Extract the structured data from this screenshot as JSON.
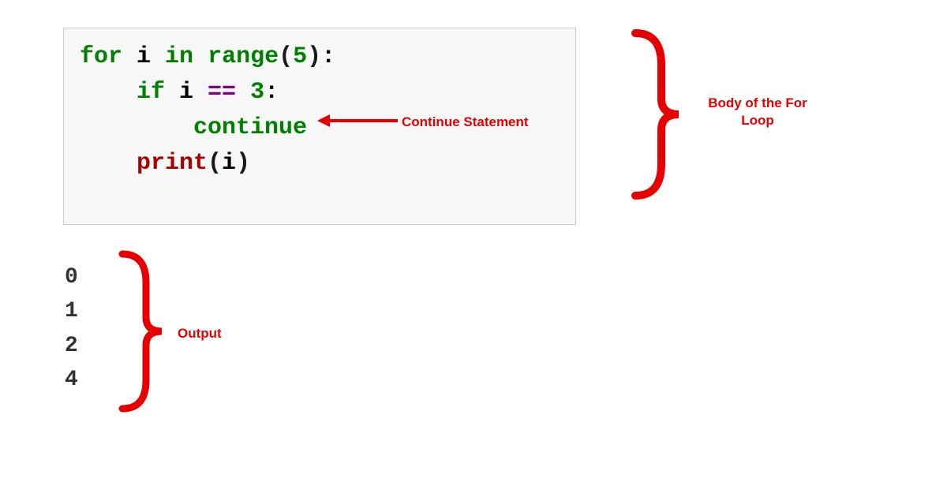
{
  "code": {
    "line1": {
      "for": "for",
      "var": " i ",
      "in": "in",
      "space": " ",
      "range": "range",
      "open": "(",
      "num": "5",
      "close": ")",
      "colon": ":"
    },
    "line2": {
      "indent": "    ",
      "if": "if",
      "var": " i ",
      "eq": "==",
      "space": " ",
      "num": "3",
      "colon": ":"
    },
    "line3": {
      "indent": "        ",
      "continue": "continue"
    },
    "line4": {
      "indent": "    ",
      "print": "print",
      "open": "(",
      "var": "i",
      "close": ")"
    }
  },
  "output": {
    "lines": [
      "0",
      "1",
      "2",
      "4"
    ]
  },
  "annotations": {
    "continue_statement": "Continue Statement",
    "body_label": "Body of the For Loop",
    "output_label": "Output"
  }
}
